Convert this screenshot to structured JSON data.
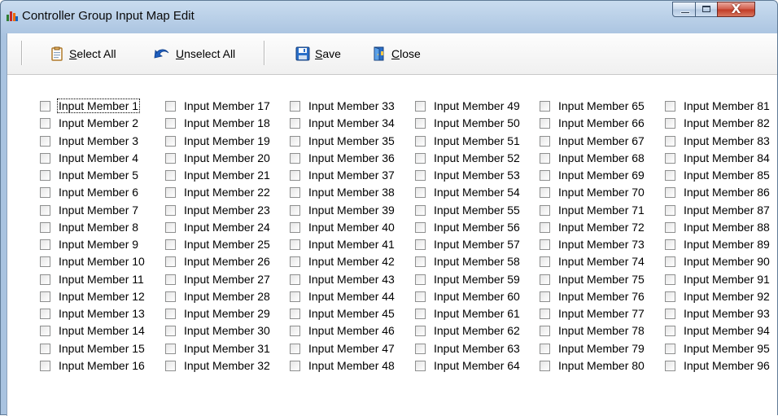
{
  "window": {
    "title": "Controller Group Input Map Edit"
  },
  "title_controls": {
    "close_glyph": "X"
  },
  "toolbar": {
    "select_all": {
      "mnemonic": "S",
      "rest": "elect All"
    },
    "unselect_all": {
      "mnemonic": "U",
      "rest": "nselect All"
    },
    "save": {
      "mnemonic": "S",
      "rest": "ave"
    },
    "close": {
      "mnemonic": "C",
      "rest": "lose"
    }
  },
  "members": [
    "Input Member 1",
    "Input Member 2",
    "Input Member 3",
    "Input Member 4",
    "Input Member 5",
    "Input Member 6",
    "Input Member 7",
    "Input Member 8",
    "Input Member 9",
    "Input Member 10",
    "Input Member 11",
    "Input Member 12",
    "Input Member 13",
    "Input Member 14",
    "Input Member 15",
    "Input Member 16",
    "Input Member 17",
    "Input Member 18",
    "Input Member 19",
    "Input Member 20",
    "Input Member 21",
    "Input Member 22",
    "Input Member 23",
    "Input Member 24",
    "Input Member 25",
    "Input Member 26",
    "Input Member 27",
    "Input Member 28",
    "Input Member 29",
    "Input Member 30",
    "Input Member 31",
    "Input Member 32",
    "Input Member 33",
    "Input Member 34",
    "Input Member 35",
    "Input Member 36",
    "Input Member 37",
    "Input Member 38",
    "Input Member 39",
    "Input Member 40",
    "Input Member 41",
    "Input Member 42",
    "Input Member 43",
    "Input Member 44",
    "Input Member 45",
    "Input Member 46",
    "Input Member 47",
    "Input Member 48",
    "Input Member 49",
    "Input Member 50",
    "Input Member 51",
    "Input Member 52",
    "Input Member 53",
    "Input Member 54",
    "Input Member 55",
    "Input Member 56",
    "Input Member 57",
    "Input Member 58",
    "Input Member 59",
    "Input Member 60",
    "Input Member 61",
    "Input Member 62",
    "Input Member 63",
    "Input Member 64",
    "Input Member 65",
    "Input Member 66",
    "Input Member 67",
    "Input Member 68",
    "Input Member 69",
    "Input Member 70",
    "Input Member 71",
    "Input Member 72",
    "Input Member 73",
    "Input Member 74",
    "Input Member 75",
    "Input Member 76",
    "Input Member 77",
    "Input Member 78",
    "Input Member 79",
    "Input Member 80",
    "Input Member 81",
    "Input Member 82",
    "Input Member 83",
    "Input Member 84",
    "Input Member 85",
    "Input Member 86",
    "Input Member 87",
    "Input Member 88",
    "Input Member 89",
    "Input Member 90",
    "Input Member 91",
    "Input Member 92",
    "Input Member 93",
    "Input Member 94",
    "Input Member 95",
    "Input Member 96"
  ],
  "checked": [],
  "focused_member": "Input Member 1",
  "icons": {
    "app": "chart-bars-icon",
    "select_all": "clipboard-icon",
    "unselect_all": "undo-arrow-icon",
    "save": "floppy-disk-icon",
    "close": "door-exit-icon"
  }
}
